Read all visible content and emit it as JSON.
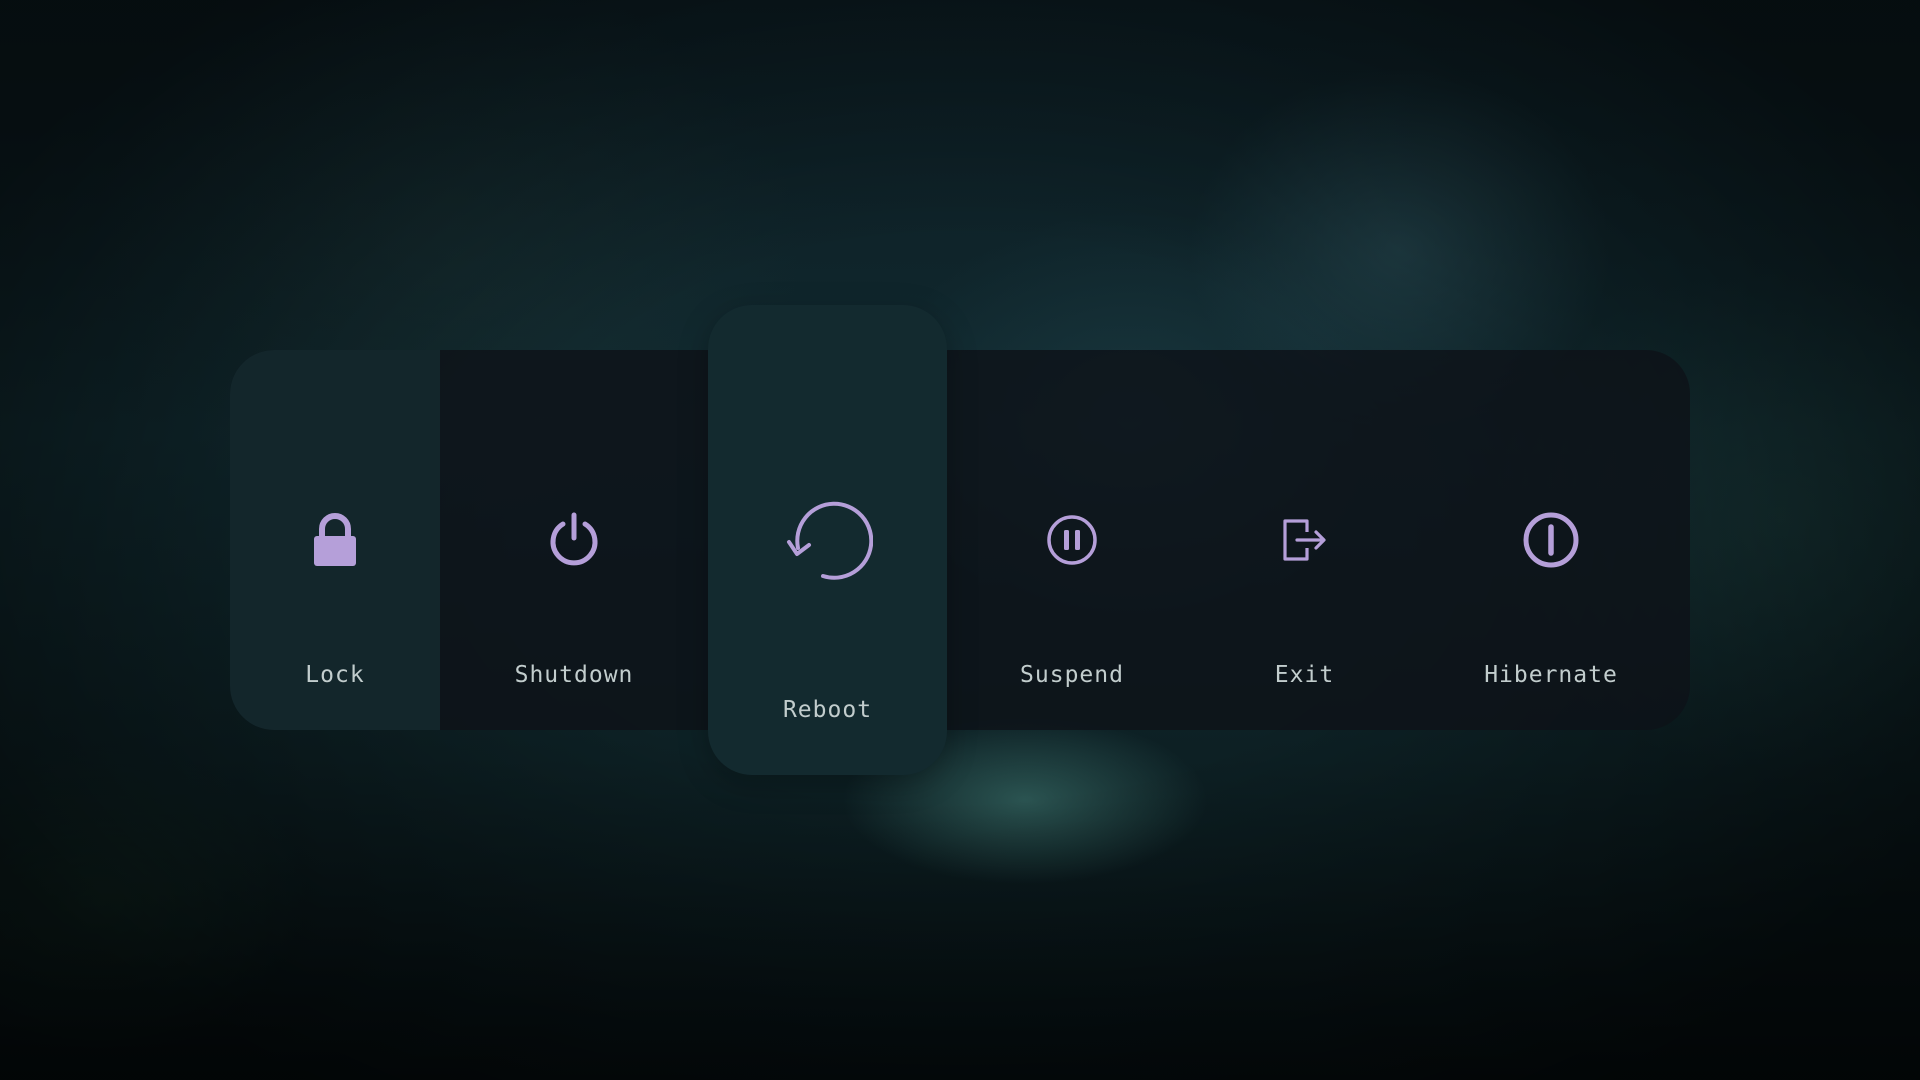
{
  "theme": {
    "accent": "#b59fd9",
    "label_color": "#c2cdcd",
    "panel_background": "#0d1218",
    "selected_background": "#132a2f"
  },
  "power_menu": {
    "selected": "reboot",
    "items": [
      {
        "id": "lock",
        "label": "Lock",
        "icon": "lock-icon"
      },
      {
        "id": "shutdown",
        "label": "Shutdown",
        "icon": "power-icon"
      },
      {
        "id": "reboot",
        "label": "Reboot",
        "icon": "reboot-icon"
      },
      {
        "id": "suspend",
        "label": "Suspend",
        "icon": "pause-circle-icon"
      },
      {
        "id": "exit",
        "label": "Exit",
        "icon": "logout-icon"
      },
      {
        "id": "hibernate",
        "label": "Hibernate",
        "icon": "hibernate-icon"
      }
    ]
  }
}
